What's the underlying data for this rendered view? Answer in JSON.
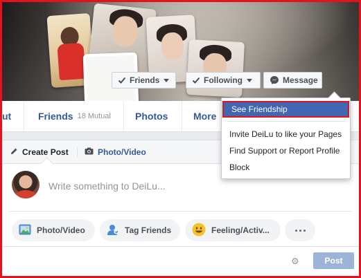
{
  "cover_buttons": {
    "friends_label": "Friends",
    "following_label": "Following",
    "message_label": "Message"
  },
  "nav": {
    "about_label": "ut",
    "friends_label": "Friends",
    "friends_mutual": "18 Mutual",
    "photos_label": "Photos",
    "more_label": "More"
  },
  "menu": {
    "items": [
      {
        "label": "See Friendship"
      },
      {
        "label": "Invite DeiLu to like your Pages"
      },
      {
        "label": "Find Support or Report Profile"
      },
      {
        "label": "Block"
      }
    ]
  },
  "composer": {
    "create_post_label": "Create Post",
    "photo_video_tab_label": "Photo/Video",
    "placeholder": "Write something to DeiLu...",
    "actions": {
      "photo_video": "Photo/Video",
      "tag_friends": "Tag Friends",
      "feeling": "Feeling/Activ..."
    },
    "post_label": "Post"
  },
  "colors": {
    "link_blue": "#365899",
    "menu_highlight": "#4267b2",
    "annotation_red": "#e4121f",
    "post_button_disabled": "#9cb4d8"
  }
}
